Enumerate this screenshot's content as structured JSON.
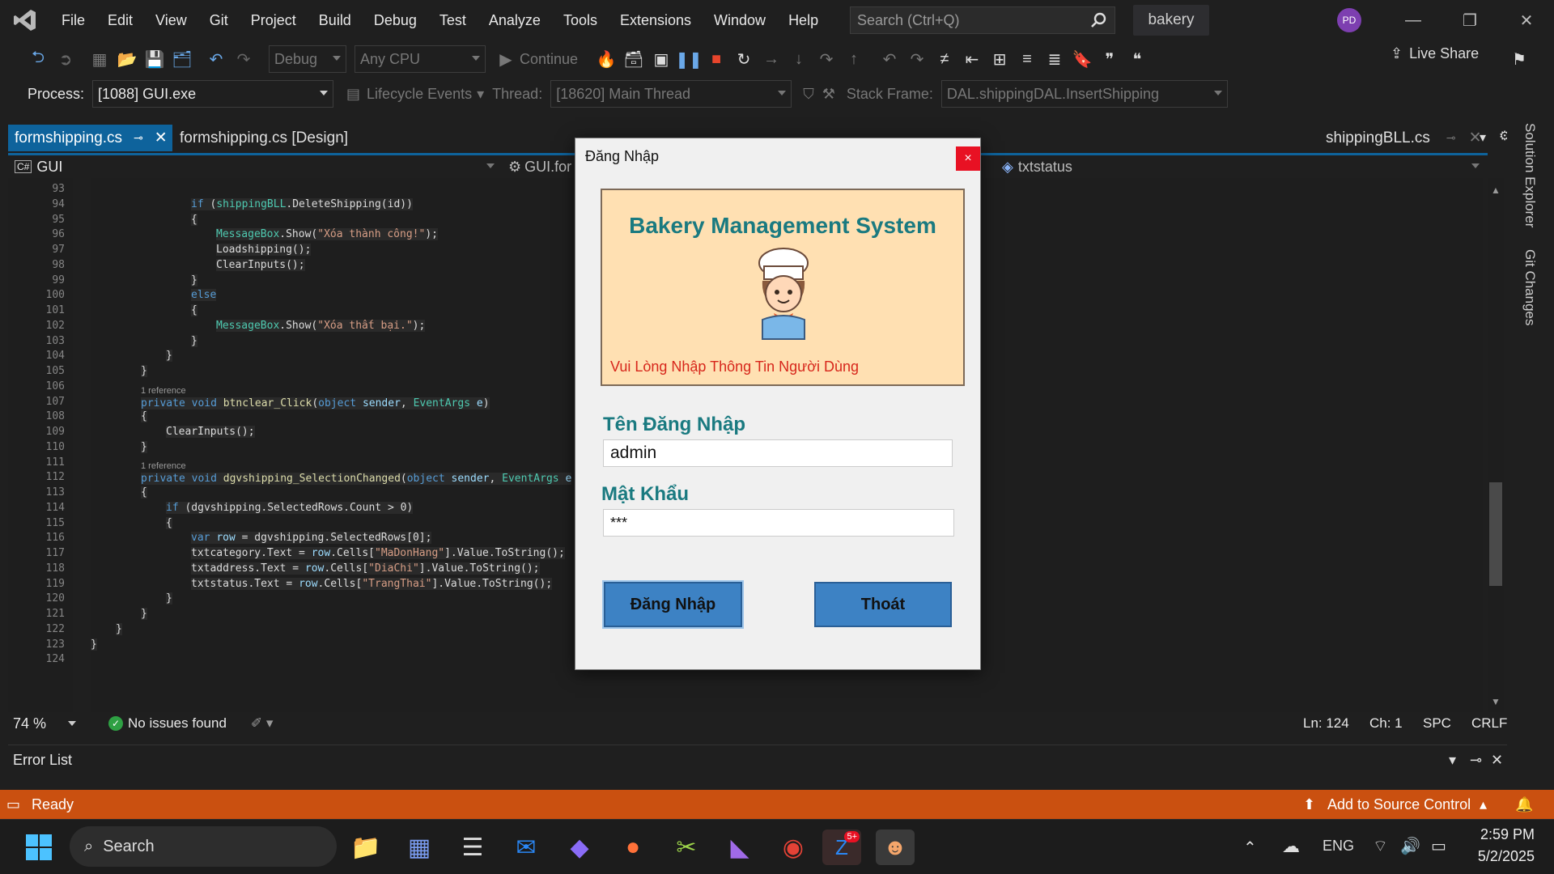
{
  "menu": [
    "File",
    "Edit",
    "View",
    "Git",
    "Project",
    "Build",
    "Debug",
    "Test",
    "Analyze",
    "Tools",
    "Extensions",
    "Window",
    "Help"
  ],
  "search": {
    "placeholder": "Search (Ctrl+Q)"
  },
  "solution_name": "bakery",
  "user_initials": "PD",
  "toolbar": {
    "config": "Debug",
    "platform": "Any CPU",
    "continue_label": "Continue",
    "live_share": "Live Share"
  },
  "debug_bar": {
    "process_label": "Process:",
    "process_value": "[1088] GUI.exe",
    "lifecycle": "Lifecycle Events",
    "thread_label": "Thread:",
    "thread_value": "[18620] Main Thread",
    "stack_label": "Stack Frame:",
    "stack_value": "DAL.shippingDAL.InsertShipping"
  },
  "tabs": {
    "active": "formshipping.cs",
    "second": "formshipping.cs [Design]",
    "right": "shippingBLL.cs"
  },
  "nav": {
    "project": "GUI",
    "class": "GUI.for",
    "member": "txtstatus"
  },
  "right_panel": [
    "Solution Explorer",
    "Git Changes"
  ],
  "code_lines": [
    {
      "n": "93",
      "indent": 0,
      "parts": []
    },
    {
      "n": "94",
      "indent": 4,
      "parts": [
        [
          "kw",
          "if "
        ],
        [
          "",
          "("
        ],
        [
          "ty",
          "shippingBLL"
        ],
        [
          "",
          ".DeleteShipping(id))"
        ]
      ]
    },
    {
      "n": "95",
      "indent": 4,
      "parts": [
        [
          "",
          "{"
        ]
      ]
    },
    {
      "n": "96",
      "indent": 5,
      "parts": [
        [
          "ty",
          "MessageBox"
        ],
        [
          "",
          ".Show("
        ],
        [
          "st",
          "\"Xóa thành công!\""
        ],
        [
          "",
          ");"
        ]
      ]
    },
    {
      "n": "97",
      "indent": 5,
      "parts": [
        [
          "",
          "Loadshipping();"
        ]
      ]
    },
    {
      "n": "98",
      "indent": 5,
      "parts": [
        [
          "",
          "ClearInputs();"
        ]
      ]
    },
    {
      "n": "99",
      "indent": 4,
      "parts": [
        [
          "",
          "}"
        ]
      ]
    },
    {
      "n": "100",
      "indent": 4,
      "parts": [
        [
          "kw",
          "else"
        ]
      ]
    },
    {
      "n": "101",
      "indent": 4,
      "parts": [
        [
          "",
          "{"
        ]
      ]
    },
    {
      "n": "102",
      "indent": 5,
      "parts": [
        [
          "ty",
          "MessageBox"
        ],
        [
          "",
          ".Show("
        ],
        [
          "st",
          "\"Xóa thất bại.\""
        ],
        [
          "",
          ");"
        ]
      ]
    },
    {
      "n": "103",
      "indent": 4,
      "parts": [
        [
          "",
          "}"
        ]
      ]
    },
    {
      "n": "104",
      "indent": 3,
      "parts": [
        [
          "",
          "}"
        ]
      ]
    },
    {
      "n": "105",
      "indent": 2,
      "parts": [
        [
          "",
          "}"
        ]
      ]
    },
    {
      "n": "106",
      "indent": 0,
      "parts": []
    },
    {
      "n": "107",
      "indent": 2,
      "ref": "1 reference",
      "parts": [
        [
          "kw",
          "private void "
        ],
        [
          "mt",
          "btnclear_Click"
        ],
        [
          "",
          "("
        ],
        [
          "kw",
          "object "
        ],
        [
          "vr",
          "sender"
        ],
        [
          "",
          ", "
        ],
        [
          "ty",
          "EventArgs "
        ],
        [
          "vr",
          "e"
        ],
        [
          "",
          ")"
        ]
      ]
    },
    {
      "n": "108",
      "indent": 2,
      "parts": [
        [
          "",
          "{"
        ]
      ]
    },
    {
      "n": "109",
      "indent": 3,
      "parts": [
        [
          "",
          "ClearInputs();"
        ]
      ]
    },
    {
      "n": "110",
      "indent": 2,
      "parts": [
        [
          "",
          "}"
        ]
      ]
    },
    {
      "n": "111",
      "indent": 0,
      "parts": []
    },
    {
      "n": "112",
      "indent": 2,
      "ref": "1 reference",
      "parts": [
        [
          "kw",
          "private void "
        ],
        [
          "mt",
          "dgvshipping_SelectionChanged"
        ],
        [
          "",
          "("
        ],
        [
          "kw",
          "object "
        ],
        [
          "vr",
          "sender"
        ],
        [
          "",
          ", "
        ],
        [
          "ty",
          "EventArgs "
        ],
        [
          "vr",
          "e"
        ]
      ]
    },
    {
      "n": "113",
      "indent": 2,
      "parts": [
        [
          "",
          "{"
        ]
      ]
    },
    {
      "n": "114",
      "indent": 3,
      "parts": [
        [
          "kw",
          "if "
        ],
        [
          "",
          "(dgvshipping.SelectedRows.Count > 0)"
        ]
      ]
    },
    {
      "n": "115",
      "indent": 3,
      "parts": [
        [
          "",
          "{"
        ]
      ]
    },
    {
      "n": "116",
      "indent": 4,
      "parts": [
        [
          "kw",
          "var "
        ],
        [
          "vr",
          "row"
        ],
        [
          "",
          " = dgvshipping.SelectedRows[0];"
        ]
      ]
    },
    {
      "n": "117",
      "indent": 4,
      "parts": [
        [
          "",
          "txtcategory.Text = "
        ],
        [
          "vr",
          "row"
        ],
        [
          "",
          ".Cells["
        ],
        [
          "st",
          "\"MaDonHang\""
        ],
        [
          "",
          "].Value.ToString();"
        ]
      ]
    },
    {
      "n": "118",
      "indent": 4,
      "parts": [
        [
          "",
          "txtaddress.Text = "
        ],
        [
          "vr",
          "row"
        ],
        [
          "",
          ".Cells["
        ],
        [
          "st",
          "\"DiaChi\""
        ],
        [
          "",
          "].Value.ToString();"
        ]
      ]
    },
    {
      "n": "119",
      "indent": 4,
      "parts": [
        [
          "",
          "txtstatus.Text = "
        ],
        [
          "vr",
          "row"
        ],
        [
          "",
          ".Cells["
        ],
        [
          "st",
          "\"TrangThai\""
        ],
        [
          "",
          "].Value.ToString();"
        ]
      ]
    },
    {
      "n": "120",
      "indent": 3,
      "parts": [
        [
          "",
          "}"
        ]
      ]
    },
    {
      "n": "121",
      "indent": 2,
      "parts": [
        [
          "",
          "}"
        ]
      ]
    },
    {
      "n": "122",
      "indent": 1,
      "parts": [
        [
          "",
          "}"
        ]
      ]
    },
    {
      "n": "123",
      "indent": 0,
      "parts": [
        [
          "",
          "}"
        ]
      ]
    },
    {
      "n": "124",
      "indent": 0,
      "parts": []
    }
  ],
  "editor_status": {
    "zoom": "74 %",
    "issues": "No issues found",
    "ln": "Ln: 124",
    "ch": "Ch: 1",
    "spc": "SPC",
    "crlf": "CRLF"
  },
  "error_list": "Error List",
  "status_bar": {
    "ready": "Ready",
    "source_control": "Add to Source Control"
  },
  "dialog": {
    "title": "Đăng Nhập",
    "close": "×",
    "banner_title": "Bakery Management System",
    "banner_sub": "Vui Lòng Nhập Thông Tin Người Dùng",
    "username_label": "Tên Đăng Nhập",
    "username_value": "admin",
    "password_label": "Mật Khẩu",
    "password_value": "***",
    "login_button": "Đăng Nhập",
    "exit_button": "Thoát"
  },
  "taskbar": {
    "search": "Search",
    "lang": "ENG",
    "time": "2:59 PM",
    "date": "5/2/2025",
    "zalo_badge": "5+"
  },
  "colors": {
    "accent": "#0e639c",
    "status_bar": "#ca5010",
    "dialog_teal": "#1a7a80",
    "dialog_red": "#d7261b",
    "banner_bg": "#ffe0b2",
    "button_blue": "#3d82c4"
  }
}
